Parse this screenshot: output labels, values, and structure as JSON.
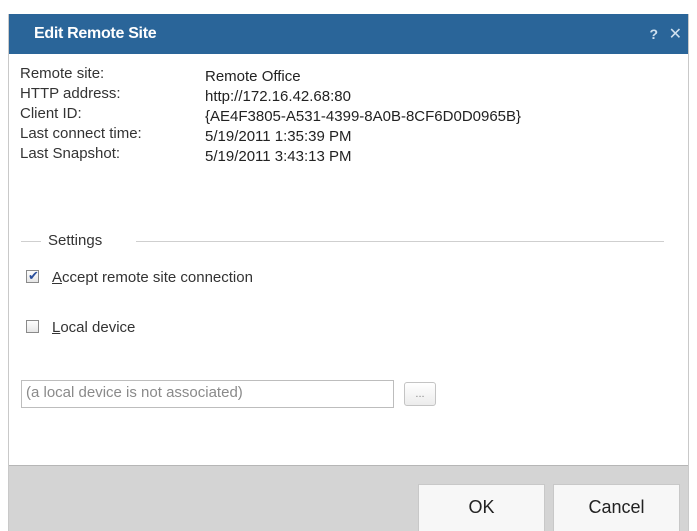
{
  "dialog": {
    "title": "Edit Remote Site",
    "help_label": "?",
    "close_label": "✕"
  },
  "info": {
    "rows": [
      {
        "label": "Remote site:",
        "value": "Remote Office"
      },
      {
        "label": "HTTP address:",
        "value": "http://172.16.42.68:80"
      },
      {
        "label": "Client ID:",
        "value": "{AE4F3805-A531-4399-8A0B-8CF6D0D0965B}"
      },
      {
        "label": "Last connect time:",
        "value": "5/19/2011 1:35:39 PM"
      },
      {
        "label": "Last Snapshot:",
        "value": "5/19/2011 3:43:13 PM"
      }
    ]
  },
  "settings": {
    "legend": "Settings",
    "accept": {
      "mnemonic": "A",
      "rest": "ccept remote site connection",
      "checked": true
    },
    "local_device": {
      "mnemonic": "L",
      "rest": "ocal device",
      "checked": false
    },
    "device_placeholder": "(a local device is not associated)",
    "browse_label": "..."
  },
  "footer": {
    "ok_label": "OK",
    "cancel_label": "Cancel"
  },
  "colors": {
    "titlebar": "#2a6599",
    "footer": "#d4d4d4"
  }
}
